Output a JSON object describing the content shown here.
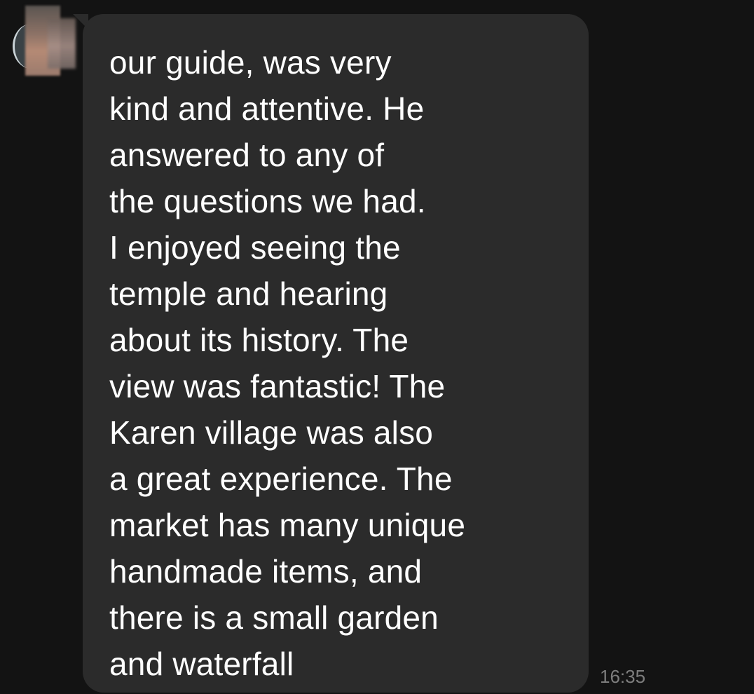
{
  "message": {
    "lines": [
      "our guide, was very",
      "kind and attentive. He",
      "answered to any of",
      "the questions we had.",
      "I enjoyed seeing the",
      "temple and hearing",
      "about its history. The",
      "view was fantastic! The",
      "Karen village was also",
      "a great experience. The",
      "market has many unique",
      "handmade items, and",
      "there is a small garden",
      "and waterfall"
    ],
    "time": "16:35"
  },
  "colors": {
    "background": "#131313",
    "bubble": "#2b2b2b",
    "text": "#ffffff",
    "timestamp": "#7d7d7d"
  },
  "icons": {
    "avatar": "blurred-profile-avatar"
  }
}
